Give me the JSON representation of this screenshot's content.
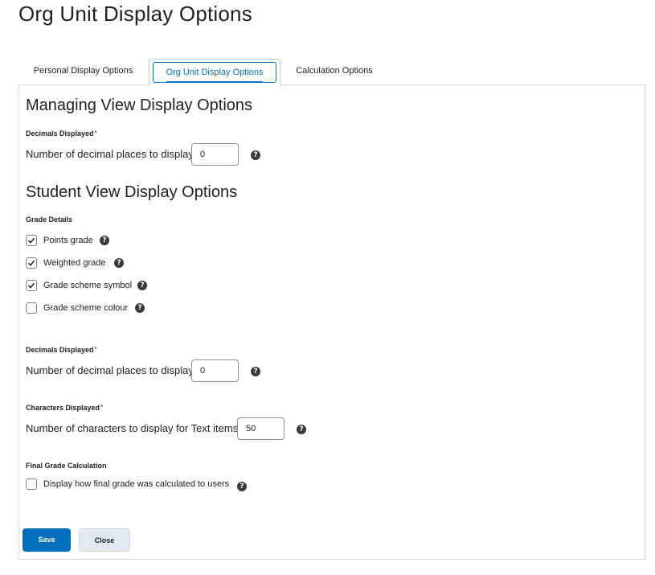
{
  "page": {
    "title": "Org Unit Display Options"
  },
  "tabs": [
    {
      "label": "Personal Display Options",
      "selected": false
    },
    {
      "label": "Org Unit Display Options",
      "selected": true
    },
    {
      "label": "Calculation Options",
      "selected": false
    }
  ],
  "managing": {
    "heading": "Managing View Display Options",
    "decimals": {
      "label": "Decimals Displayed",
      "required_mark": "*",
      "prompt": "Number of decimal places to display",
      "value": "0"
    }
  },
  "student": {
    "heading": "Student View Display Options",
    "grade_details": {
      "label": "Grade Details",
      "options": [
        {
          "label": "Points grade",
          "checked": true
        },
        {
          "label": "Weighted grade",
          "checked": true
        },
        {
          "label": "Grade scheme symbol",
          "checked": true
        },
        {
          "label": "Grade scheme colour",
          "checked": false
        }
      ]
    },
    "decimals": {
      "label": "Decimals Displayed",
      "required_mark": "*",
      "prompt": "Number of decimal places to display",
      "value": "0"
    },
    "characters": {
      "label": "Characters Displayed",
      "required_mark": "*",
      "prompt": "Number of characters to display for Text items",
      "value": "50"
    },
    "final_grade": {
      "label": "Final Grade Calculation",
      "option": {
        "label": "Display how final grade was calculated to users",
        "checked": false
      }
    }
  },
  "actions": {
    "save_label": "Save",
    "close_label": "Close"
  },
  "help_glyph": "?",
  "colors": {
    "primary": "#006fbf",
    "secondary_btn": "#e3e9f1",
    "border": "#d3d9e3"
  }
}
